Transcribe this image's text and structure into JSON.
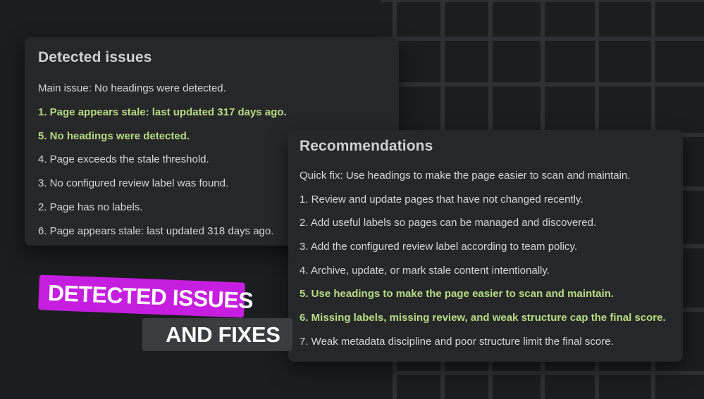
{
  "issues_panel": {
    "title": "Detected issues",
    "items": [
      {
        "text": "Main issue: No headings were detected.",
        "highlight": false
      },
      {
        "text": "1. Page appears stale: last updated 317 days ago.",
        "highlight": true
      },
      {
        "text": "5. No headings were detected.",
        "highlight": true
      },
      {
        "text": "4. Page exceeds the stale threshold.",
        "highlight": false
      },
      {
        "text": "3. No configured review label was found.",
        "highlight": false
      },
      {
        "text": "2. Page has no labels.",
        "highlight": false
      },
      {
        "text": "6. Page appears stale: last updated 318 days ago.",
        "highlight": false
      }
    ]
  },
  "recommendations_panel": {
    "title": "Recommendations",
    "items": [
      {
        "text": "Quick fix: Use headings to make the page easier to scan and maintain.",
        "highlight": false
      },
      {
        "text": "1. Review and update pages that have not changed recently.",
        "highlight": false
      },
      {
        "text": "2. Add useful labels so pages can be managed and discovered.",
        "highlight": false
      },
      {
        "text": "3. Add the configured review label according to team policy.",
        "highlight": false
      },
      {
        "text": "4. Archive, update, or mark stale content intentionally.",
        "highlight": false
      },
      {
        "text": "5. Use headings to make the page easier to scan and maintain.",
        "highlight": true
      },
      {
        "text": "6. Missing labels, missing review, and weak structure cap the final score.",
        "highlight": true
      },
      {
        "text": "7. Weak metadata discipline and poor structure limit the final score.",
        "highlight": false
      }
    ]
  },
  "caption": {
    "line1": "DETECTED ISSUES",
    "line2": "AND FIXES"
  },
  "colors": {
    "background": "#1c1d1f",
    "panel": "#262729",
    "highlight_text": "#b6dc83",
    "tag_magenta": "#c51ee0",
    "tag_grey": "#3b3c3f"
  }
}
